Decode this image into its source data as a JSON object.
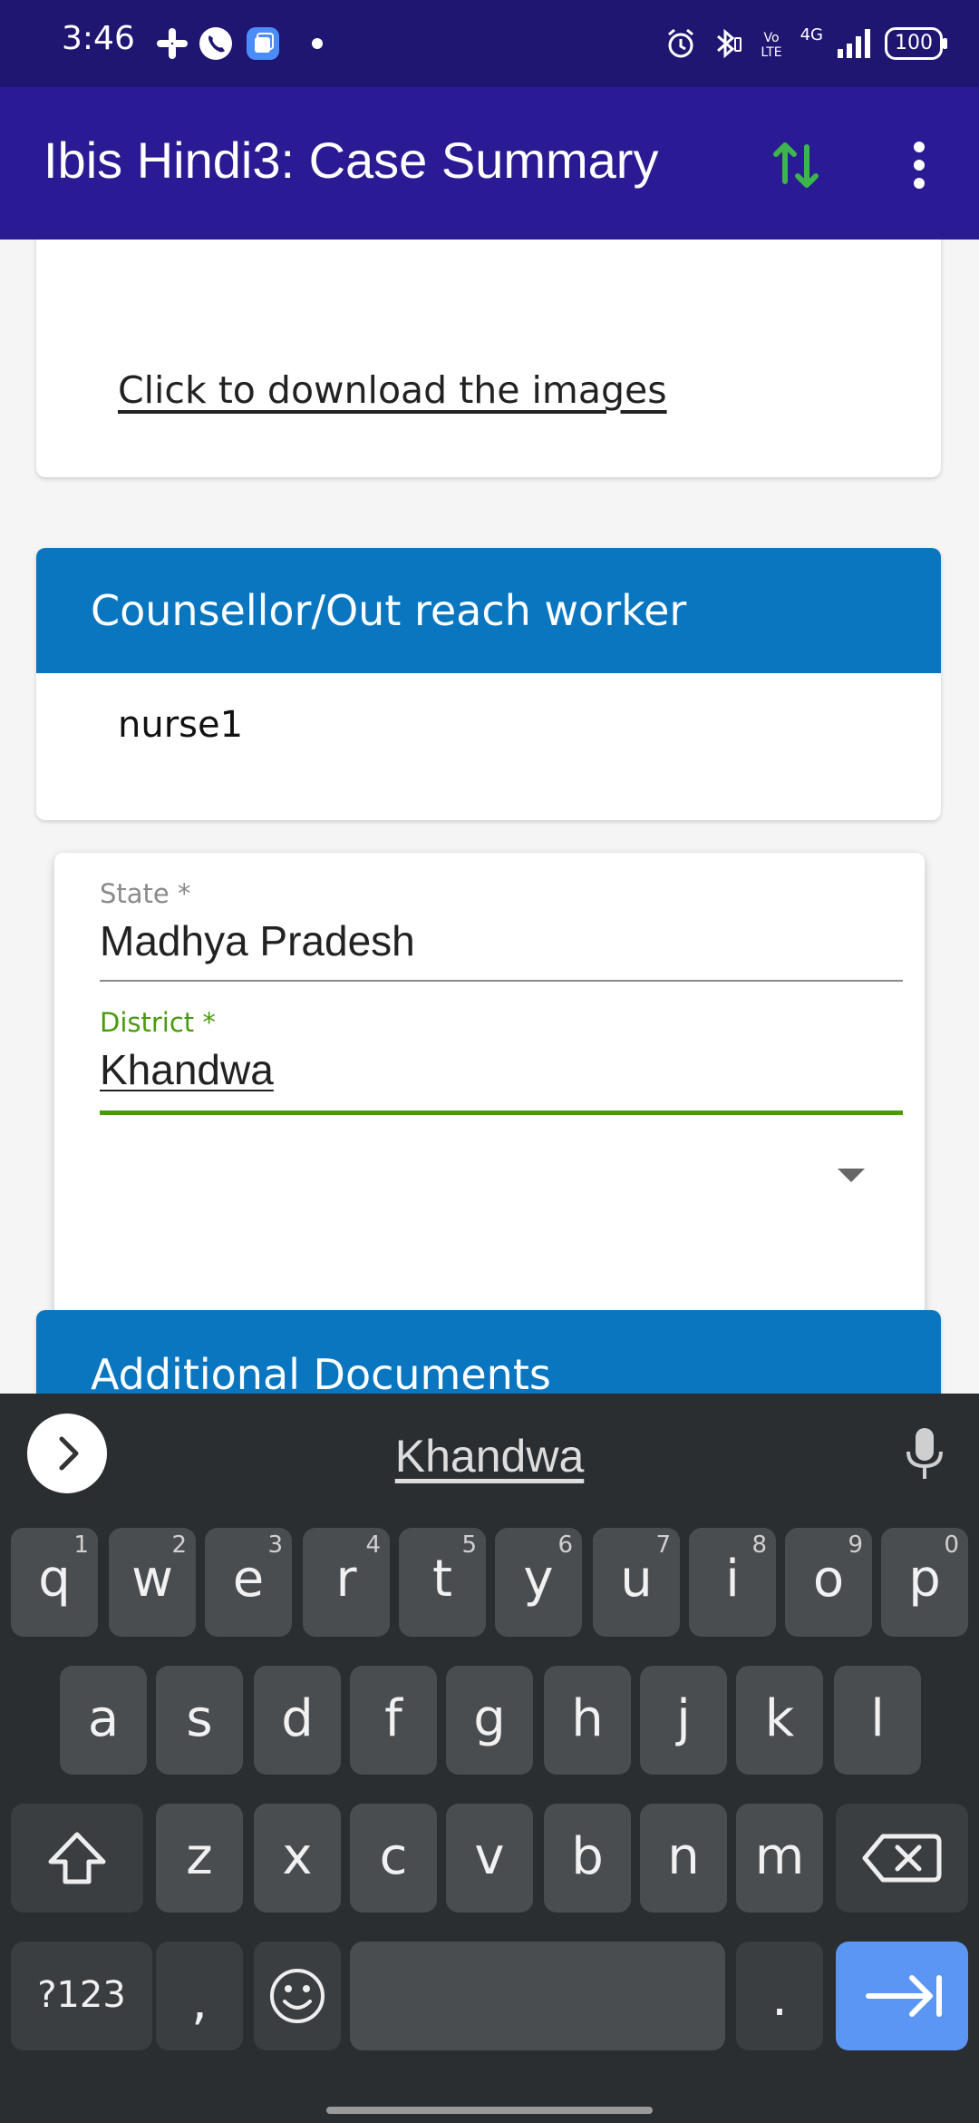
{
  "status_bar": {
    "time": "3:46",
    "battery": "100",
    "network": "4G"
  },
  "app_bar": {
    "title": "Ibis Hindi3: Case Summary"
  },
  "images_card": {
    "download_link": "Click to download the images"
  },
  "counsellor_card": {
    "header": "Counsellor/Out reach worker",
    "value": "nurse1"
  },
  "location_card": {
    "state_label": "State *",
    "state_value": "Madhya Pradesh",
    "district_label": "District *",
    "district_value": "Khandwa"
  },
  "additional_documents_card": {
    "header": "Additional Documents"
  },
  "keyboard": {
    "suggestion": "Khandwa",
    "rows": {
      "row1": [
        {
          "key": "q",
          "hint": "1"
        },
        {
          "key": "w",
          "hint": "2"
        },
        {
          "key": "e",
          "hint": "3"
        },
        {
          "key": "r",
          "hint": "4"
        },
        {
          "key": "t",
          "hint": "5"
        },
        {
          "key": "y",
          "hint": "6"
        },
        {
          "key": "u",
          "hint": "7"
        },
        {
          "key": "i",
          "hint": "8"
        },
        {
          "key": "o",
          "hint": "9"
        },
        {
          "key": "p",
          "hint": "0"
        }
      ],
      "row2": [
        "a",
        "s",
        "d",
        "f",
        "g",
        "h",
        "j",
        "k",
        "l"
      ],
      "row3": [
        "z",
        "x",
        "c",
        "v",
        "b",
        "n",
        "m"
      ]
    },
    "symbols_key": "?123",
    "comma_key": ",",
    "period_key": "."
  },
  "colors": {
    "status_bar": "#1f1672",
    "app_bar": "#2a1b94",
    "card_header": "#0a76c0",
    "focus_green": "#4a9a10",
    "sync_green": "#3cb54a",
    "enter_key": "#5b96f4"
  },
  "icons": {
    "sync": "sync-arrows-icon",
    "more": "more-vert-icon",
    "mic": "mic-icon",
    "shift": "shift-icon",
    "backspace": "backspace-icon",
    "emoji": "emoji-icon",
    "enter": "next-tab-icon"
  }
}
